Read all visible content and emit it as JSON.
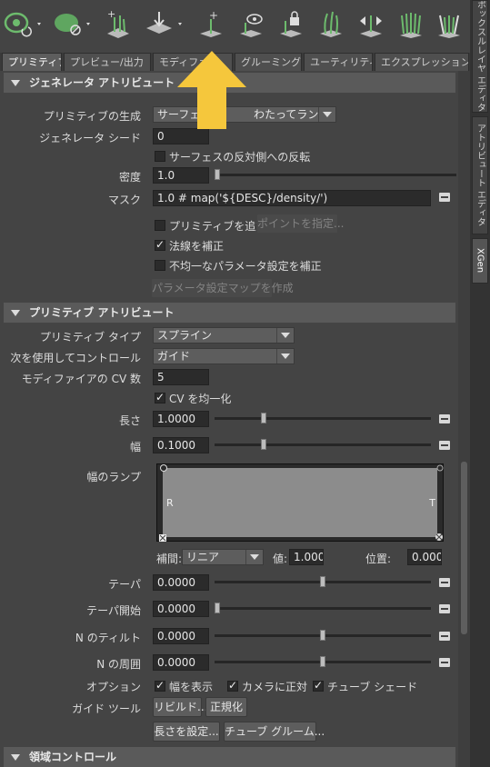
{
  "toolbar": {
    "icons": [
      "visibility-eye-icon",
      "hide-eye-icon",
      "add-guide-icon",
      "placement-icon",
      "add-primitive-icon",
      "preview-eye-icon",
      "lock-icon",
      "guides-icon",
      "flip-icon",
      "grooming-icon",
      "grooming-tool-icon"
    ]
  },
  "tabs": [
    "プリミティブ",
    "プレビュー/出力",
    "モディファ",
    "グルーミング",
    "ユーティリティ",
    "エクスプレッション"
  ],
  "right_dock": [
    "ポックスルレイヤ エディタ",
    "アトリビュート エディタ",
    "XGen"
  ],
  "sections": {
    "generator": "ジェネレータ アトリビュート",
    "primitive": "プリミティブ アトリビュート",
    "region": "領域コントロール"
  },
  "generator": {
    "creation_label": "プリミティブの生成",
    "creation_value": "サーフェス",
    "creation_value_tail": "わたってランダムに",
    "seed_label": "ジェネレータ シード",
    "seed_value": "0",
    "flip_label": "サーフェスの反対側への反転",
    "density_label": "密度",
    "density_value": "1.0",
    "mask_label": "マスク",
    "mask_value": "1.0 # map('${DESC}/density/')",
    "add_primitive_label": "プリミティブを追加",
    "specify_points_label": "ポイントを指定...",
    "correct_normals_label": "法線を補正",
    "nonuniform_label": "不均一なパラメータ設定を補正",
    "param_map_label": "パラメータ設定マップを作成"
  },
  "primitive": {
    "type_label": "プリミティブ タイプ",
    "type_value": "スプライン",
    "control_label": "次を使用してコントロール",
    "control_value": "ガイド",
    "cv_count_label": "モディファイアの CV 数",
    "cv_count_value": "5",
    "cv_uniform_label": "CV を均一化",
    "length_label": "長さ",
    "length_value": "1.0000",
    "width_label": "幅",
    "width_value": "0.1000",
    "ramp_label": "幅のランプ",
    "ramp_left": "R",
    "ramp_right": "T",
    "interp_label": "補間:",
    "interp_value": "リニア",
    "value_label": "値:",
    "value_value": "1.000",
    "position_label": "位置:",
    "position_value": "0.000",
    "taper_label": "テーパ",
    "taper_value": "0.0000",
    "taper_start_label": "テーパ開始",
    "taper_start_value": "0.0000",
    "tilt_label": "N のティルト",
    "tilt_value": "0.0000",
    "twist_label": "N の周囲",
    "twist_value": "0.0000",
    "options_label": "オプション",
    "opt_show_width": "幅を表示",
    "opt_face_camera": "カメラに正対",
    "opt_tube_shade": "チューブ シェード",
    "guide_tools_label": "ガイド ツール",
    "rebuild_btn": "リビルド...",
    "normalize_btn": "正規化",
    "set_length_btn": "長さを設定...",
    "tube_groom_btn": "チューブ グルーム..."
  },
  "sliders": {
    "density": 0.0,
    "length": 0.22,
    "width": 0.22,
    "taper": 0.5,
    "taper_start": 0.0,
    "tilt": 0.5,
    "twist": 0.5
  },
  "colors": {
    "accent_arrow": "#f5c73c",
    "icon_green": "#5fa660"
  }
}
